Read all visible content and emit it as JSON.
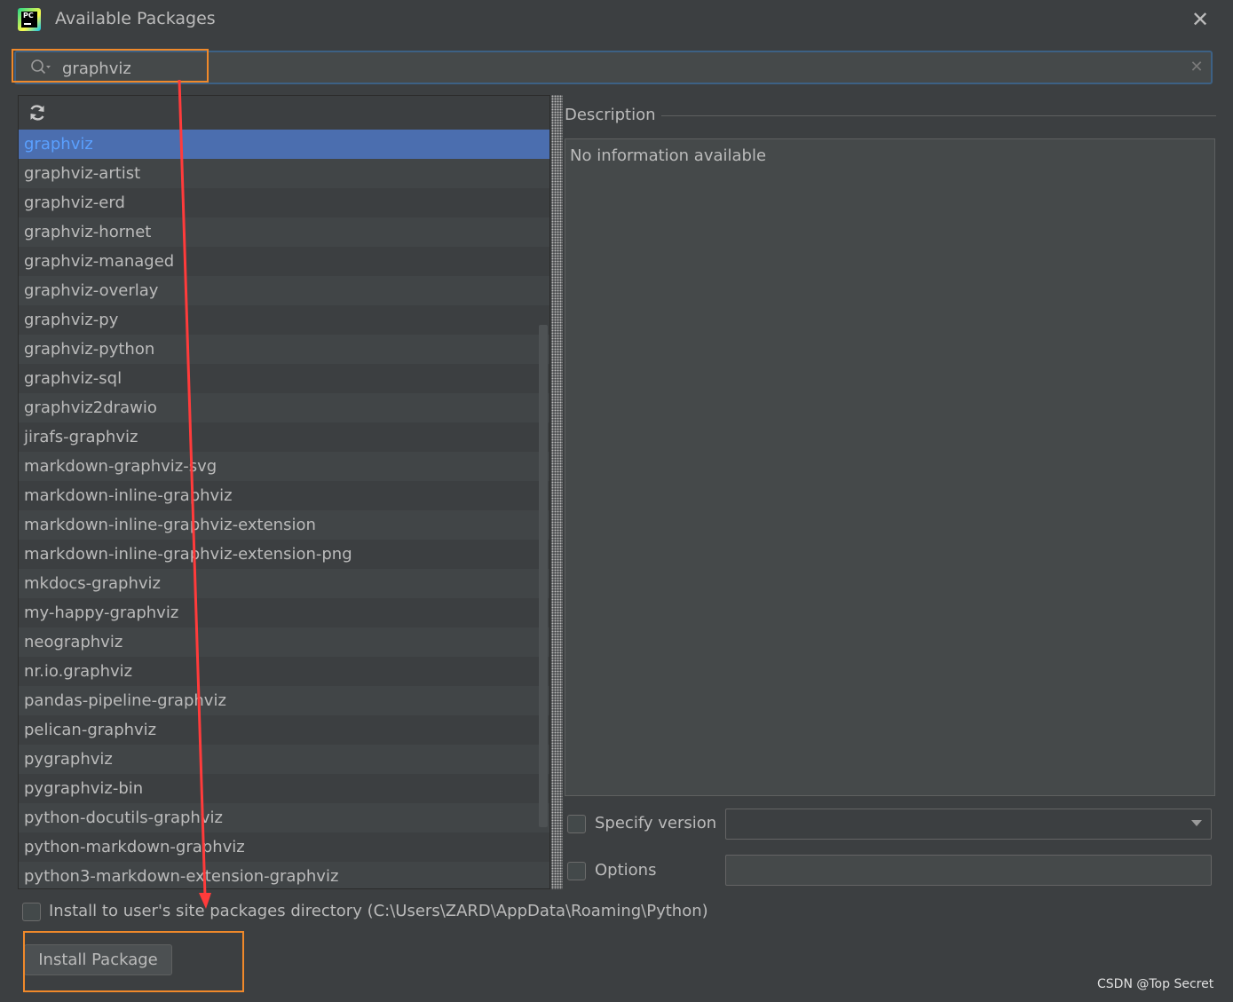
{
  "window": {
    "title": "Available Packages",
    "close_icon": "close-icon",
    "app_icon": "pycharm-icon",
    "app_icon_text": "PC"
  },
  "search": {
    "value": "graphviz",
    "icon": "search-icon",
    "clear_icon": "clear-icon"
  },
  "toolbar": {
    "refresh_icon": "refresh-icon"
  },
  "packages": {
    "selected_index": 0,
    "items": [
      "graphviz",
      "graphviz-artist",
      "graphviz-erd",
      "graphviz-hornet",
      "graphviz-managed",
      "graphviz-overlay",
      "graphviz-py",
      "graphviz-python",
      "graphviz-sql",
      "graphviz2drawio",
      "jirafs-graphviz",
      "markdown-graphviz-svg",
      "markdown-inline-graphviz",
      "markdown-inline-graphviz-extension",
      "markdown-inline-graphviz-extension-png",
      "mkdocs-graphviz",
      "my-happy-graphviz",
      "neographviz",
      "nr.io.graphviz",
      "pandas-pipeline-graphviz",
      "pelican-graphviz",
      "pygraphviz",
      "pygraphviz-bin",
      "python-docutils-graphviz",
      "python-markdown-graphviz",
      "python3-markdown-extension-graphviz"
    ]
  },
  "description": {
    "label": "Description",
    "text": "No information available"
  },
  "specify_version": {
    "label": "Specify version",
    "checked": false,
    "value": ""
  },
  "options": {
    "label": "Options",
    "checked": false,
    "value": ""
  },
  "site_packages": {
    "label": "Install to user's site packages directory (C:\\Users\\ZARD\\AppData\\Roaming\\Python)",
    "checked": false
  },
  "install_button": {
    "label": "Install Package"
  },
  "watermark": "CSDN @Top Secret",
  "colors": {
    "background": "#3c3f41",
    "selection": "#4b6eaf",
    "highlight_box": "#f0892a",
    "annotation_arrow": "#ff3b3b"
  }
}
